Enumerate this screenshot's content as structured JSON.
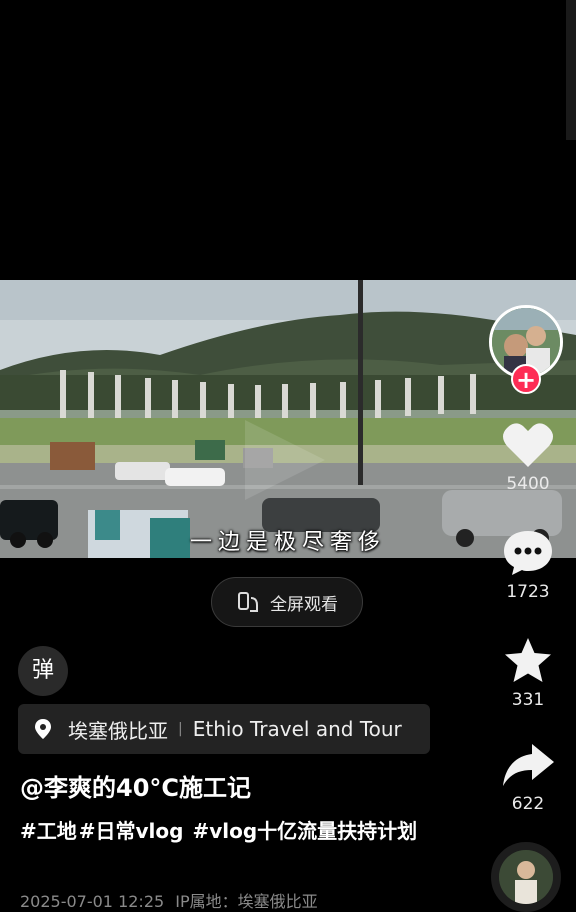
{
  "video": {
    "subtitle": "一边是极尽奢侈"
  },
  "fullscreen": {
    "label": "全屏观看",
    "icon": "fullscreen-rotate-icon"
  },
  "rail": {
    "likes": "5400",
    "comments": "1723",
    "favorites": "331",
    "shares": "622",
    "follow_symbol": "+"
  },
  "danmaku": {
    "label": "弹"
  },
  "location": {
    "place": "埃塞俄比亚",
    "separator": "|",
    "poi": "Ethio Travel and Tour"
  },
  "post": {
    "author": "@李爽的40°C施工记",
    "hashtags": [
      "#工地",
      "#日常vlog",
      "#vlog十亿流量扶持计划"
    ],
    "timestamp": "2025-07-01 12:25",
    "ip_label": "IP属地：埃塞俄比亚"
  },
  "colors": {
    "accent": "#fe2c55",
    "background": "#000000"
  }
}
